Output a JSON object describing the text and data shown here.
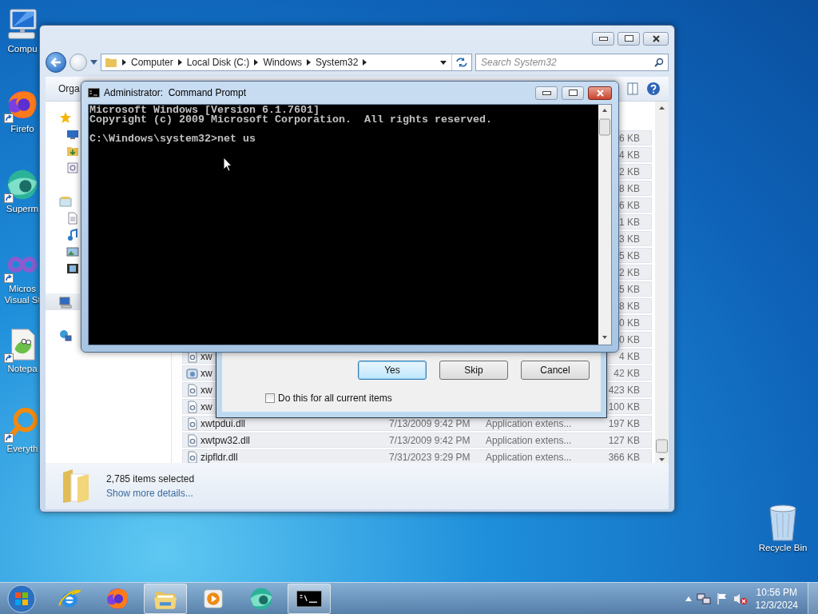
{
  "desktop": {
    "icons": [
      {
        "kind": "computer",
        "lines": [
          "Compu"
        ],
        "shortcut": false
      },
      {
        "kind": "firefox",
        "lines": [
          "Firefo"
        ],
        "shortcut": true
      },
      {
        "kind": "supermium",
        "lines": [
          "Superm"
        ],
        "shortcut": true
      },
      {
        "kind": "vs",
        "lines": [
          "Micros",
          "Visual St"
        ],
        "shortcut": true
      },
      {
        "kind": "notepad",
        "lines": [
          "Notepa"
        ],
        "shortcut": true
      },
      {
        "kind": "everything",
        "lines": [
          "Everyth"
        ],
        "shortcut": true
      }
    ],
    "recycle_bin": {
      "label": "Recycle Bin"
    }
  },
  "explorer": {
    "address": {
      "segments": [
        "Computer",
        "Local Disk (C:)",
        "Windows",
        "System32"
      ]
    },
    "search": {
      "placeholder": "Search System32"
    },
    "toolbar": {
      "organize": "Orga"
    },
    "nav": [
      {
        "kind": "favorites",
        "selected": false,
        "children": [
          {
            "kind": "desktop",
            "selected": false
          },
          {
            "kind": "downloads",
            "selected": false
          },
          {
            "kind": "recent",
            "selected": false
          }
        ]
      },
      {
        "kind": "libraries",
        "selected": false,
        "children": [
          {
            "kind": "documents",
            "selected": false
          },
          {
            "kind": "music",
            "selected": false
          },
          {
            "kind": "pictures",
            "selected": false
          },
          {
            "kind": "videos",
            "selected": false
          }
        ]
      },
      {
        "kind": "computer",
        "selected": true
      },
      {
        "kind": "network",
        "selected": false
      }
    ],
    "files": [
      {
        "size": "6 KB",
        "selected": true
      },
      {
        "size": "4 KB",
        "selected": true
      },
      {
        "size": "2 KB",
        "selected": true
      },
      {
        "size": "8 KB",
        "selected": true
      },
      {
        "size": "6 KB",
        "selected": true
      },
      {
        "size": "1 KB",
        "selected": true
      },
      {
        "size": "3 KB",
        "selected": true
      },
      {
        "size": "5 KB",
        "selected": true
      },
      {
        "size": "2 KB",
        "selected": true
      },
      {
        "size": "5 KB",
        "selected": true
      },
      {
        "size": "8 KB",
        "selected": true
      },
      {
        "size": "0 KB",
        "selected": true
      },
      {
        "size": "0 KB",
        "selected": true
      },
      {
        "kind": "dll",
        "name": "xw",
        "size": "4 KB",
        "selected": true
      },
      {
        "kind": "program",
        "name": "xw",
        "size": "42 KB",
        "selected": true
      },
      {
        "kind": "dll",
        "name": "xw",
        "size": "423 KB",
        "selected": true
      },
      {
        "kind": "dll",
        "name": "xw",
        "size": "100 KB",
        "selected": true
      },
      {
        "kind": "dll",
        "name": "xwtpdui.dll",
        "date": "7/13/2009 9:42 PM",
        "type": "Application extens...",
        "size": "197 KB",
        "selected": true
      },
      {
        "kind": "dll",
        "name": "xwtpw32.dll",
        "date": "7/13/2009 9:42 PM",
        "type": "Application extens...",
        "size": "127 KB",
        "selected": true
      },
      {
        "kind": "dll",
        "name": "zipfldr.dll",
        "date": "7/31/2023 9:29 PM",
        "type": "Application extens...",
        "size": "366 KB",
        "selected": true
      }
    ],
    "status": {
      "count": "2,785 items selected",
      "details": "Show more details..."
    }
  },
  "dialog": {
    "buttons": [
      {
        "label": "Yes",
        "focused": true
      },
      {
        "label": "Skip",
        "focused": false
      },
      {
        "label": "Cancel",
        "focused": false
      }
    ],
    "checkbox": {
      "label": "Do this for all current items",
      "checked": false
    }
  },
  "console": {
    "title": "Administrator:  Command Prompt",
    "paragraphs": [
      {
        "lines": [
          "Microsoft Windows [Version 6.1.7601]",
          "Copyright (c) 2009 Microsoft Corporation.  All rights reserved."
        ]
      },
      {
        "lines": [
          "C:\\Windows\\system32>net us"
        ]
      }
    ]
  },
  "taskbar": {
    "items": [
      {
        "kind": "ie",
        "running": false
      },
      {
        "kind": "firefox",
        "running": false
      },
      {
        "kind": "explorer",
        "running": true
      },
      {
        "kind": "media",
        "running": false
      },
      {
        "kind": "supermium",
        "running": false
      },
      {
        "kind": "cmd",
        "running": true
      }
    ],
    "tray": {
      "time": "10:56 PM",
      "date": "12/3/2024"
    }
  }
}
